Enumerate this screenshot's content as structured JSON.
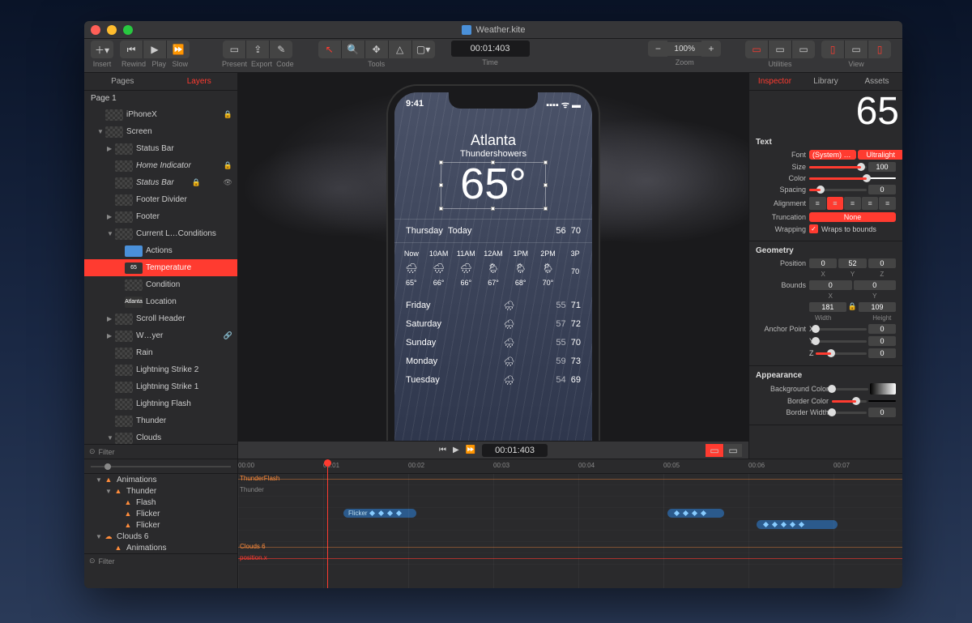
{
  "window": {
    "title": "Weather.kite"
  },
  "toolbar": {
    "insert": "Insert",
    "rewind": "Rewind",
    "play": "Play",
    "slow": "Slow",
    "present": "Present",
    "export": "Export",
    "code": "Code",
    "tools": "Tools",
    "time": "Time",
    "time_value": "00:01:403",
    "zoom": "Zoom",
    "zoom_value": "100%",
    "utilities": "Utilities",
    "view": "View"
  },
  "sidebar": {
    "tabs": {
      "pages": "Pages",
      "layers": "Layers"
    },
    "page": "Page 1",
    "items": [
      {
        "label": "iPhoneX",
        "d": 1,
        "locked": true
      },
      {
        "label": "Screen",
        "d": 1,
        "open": true
      },
      {
        "label": "Status Bar",
        "d": 2,
        "arrow": true
      },
      {
        "label": "Home Indicator",
        "d": 2,
        "locked": true,
        "italic": true
      },
      {
        "label": "Status Bar",
        "d": 2,
        "locked": true,
        "eye": true,
        "italic": true
      },
      {
        "label": "Footer Divider",
        "d": 2
      },
      {
        "label": "Footer",
        "d": 2,
        "arrow": true
      },
      {
        "label": "Current L…Conditions",
        "d": 2,
        "open": true
      },
      {
        "label": "Actions",
        "d": 3,
        "icon": "actions"
      },
      {
        "label": "Temperature",
        "d": 3,
        "sel": true,
        "thumb": "65"
      },
      {
        "label": "Condition",
        "d": 3
      },
      {
        "label": "Location",
        "d": 3,
        "thumb": "Atlanta"
      },
      {
        "label": "Scroll Header",
        "d": 2,
        "arrow": true
      },
      {
        "label": "W…yer",
        "d": 2,
        "arrow": true,
        "link": true
      },
      {
        "label": "Rain",
        "d": 2
      },
      {
        "label": "Lightning Strike 2",
        "d": 2
      },
      {
        "label": "Lightning Strike 1",
        "d": 2
      },
      {
        "label": "Lightning Flash",
        "d": 2
      },
      {
        "label": "Thunder",
        "d": 2
      },
      {
        "label": "Clouds",
        "d": 2,
        "open": true
      }
    ],
    "filter": "Filter"
  },
  "canvas": {
    "statusbar": {
      "time": "9:41",
      "signal": "▪▪▪▪ ᯤ ▬"
    },
    "city": "Atlanta",
    "condition": "Thundershowers",
    "temp": "65°",
    "day_header": {
      "day": "Thursday",
      "today": "Today",
      "lo": "56",
      "hi": "70"
    },
    "hourly": [
      {
        "t": "Now",
        "i": "🌧",
        "temp": "65°"
      },
      {
        "t": "10AM",
        "i": "🌧",
        "temp": "66°"
      },
      {
        "t": "11AM",
        "i": "🌧",
        "temp": "66°"
      },
      {
        "t": "12AM",
        "i": "🌦",
        "temp": "67°"
      },
      {
        "t": "1PM",
        "i": "🌦",
        "temp": "68°"
      },
      {
        "t": "2PM",
        "i": "🌦",
        "temp": "70°"
      },
      {
        "t": "3P",
        "i": "",
        "temp": "70"
      }
    ],
    "daily": [
      {
        "d": "Friday",
        "i": "🌧",
        "lo": "55",
        "hi": "71"
      },
      {
        "d": "Saturday",
        "i": "🌧",
        "lo": "57",
        "hi": "72"
      },
      {
        "d": "Sunday",
        "i": "🌧",
        "lo": "55",
        "hi": "70"
      },
      {
        "d": "Monday",
        "i": "🌧",
        "lo": "59",
        "hi": "73"
      },
      {
        "d": "Tuesday",
        "i": "🌧",
        "lo": "54",
        "hi": "69"
      }
    ],
    "playbar_time": "00:01:403"
  },
  "inspector": {
    "tabs": {
      "inspector": "Inspector",
      "library": "Library",
      "assets": "Assets"
    },
    "preview": "65",
    "text": {
      "title": "Text",
      "font_lbl": "Font",
      "font_family": "(System) San…",
      "font_weight": "Ultralight",
      "size_lbl": "Size",
      "size": "100",
      "color_lbl": "Color",
      "spacing_lbl": "Spacing",
      "spacing": "0",
      "alignment_lbl": "Alignment",
      "truncation_lbl": "Truncation",
      "truncation": "None",
      "wrapping_lbl": "Wrapping",
      "wrapping_val": "Wraps to bounds"
    },
    "geometry": {
      "title": "Geometry",
      "position_lbl": "Position",
      "px": "0",
      "py": "52",
      "pz": "0",
      "xl": "X",
      "yl": "Y",
      "zl": "Z",
      "bounds_lbl": "Bounds",
      "bx": "0",
      "by": "0",
      "width": "181",
      "height": "109",
      "wlbl": "Width",
      "hlbl": "Height",
      "lock": "🔒",
      "anchor_lbl": "Anchor Point",
      "ax": "X",
      "ay": "Y",
      "az": "Z",
      "av": "0"
    },
    "appearance": {
      "title": "Appearance",
      "bg_lbl": "Background Color",
      "border_color_lbl": "Border Color",
      "border_width_lbl": "Border Width",
      "border_width": "0"
    }
  },
  "timeline": {
    "ticks": [
      "00:00",
      "00:01",
      "00:02",
      "00:03",
      "00:04",
      "00:05",
      "00:06",
      "00:07"
    ],
    "items": [
      {
        "label": "Animations",
        "d": 0,
        "open": true,
        "icon": "A"
      },
      {
        "label": "Thunder",
        "d": 1,
        "open": true,
        "icon": "T"
      },
      {
        "label": "Flash",
        "d": 2,
        "icon": "T"
      },
      {
        "label": "Flicker",
        "d": 2,
        "icon": "T"
      },
      {
        "label": "Flicker",
        "d": 2,
        "icon": "T"
      },
      {
        "label": "Clouds 6",
        "d": 0,
        "open": true,
        "icon": "C"
      },
      {
        "label": "Animations",
        "d": 1,
        "icon": "A"
      }
    ],
    "track_labels": {
      "thunderflash": "ThunderFlash",
      "thunder": "Thunder",
      "flicker": "Flicker",
      "clouds6": "Clouds 6",
      "positionx": "position.x"
    },
    "filter": "Filter"
  }
}
